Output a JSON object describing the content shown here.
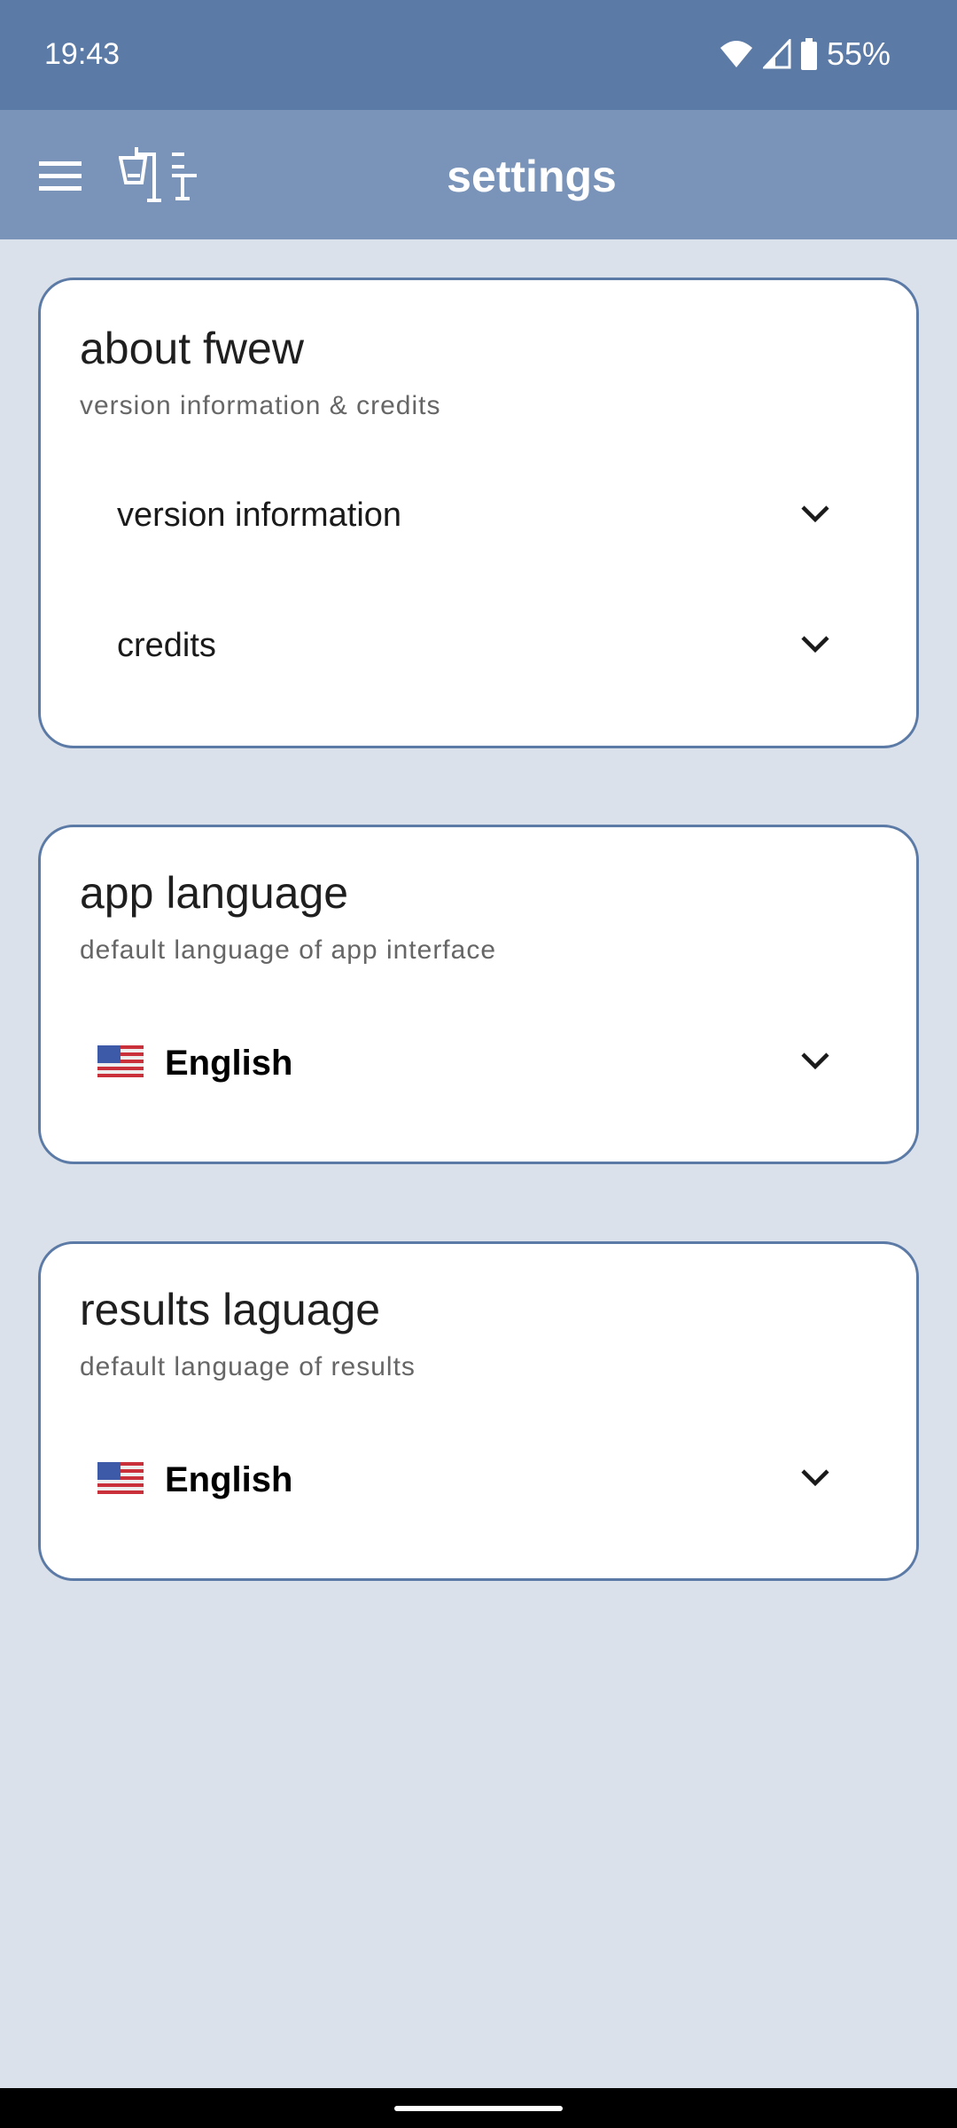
{
  "status": {
    "time": "19:43",
    "battery": "55%"
  },
  "appbar": {
    "title": "settings"
  },
  "about": {
    "title": "about fwew",
    "subtitle": "version information & credits",
    "items": [
      {
        "label": "version information"
      },
      {
        "label": "credits"
      }
    ]
  },
  "app_language": {
    "title": "app language",
    "subtitle": "default language of app interface",
    "selected": "English"
  },
  "results_language": {
    "title": "results laguage",
    "subtitle": "default language of results",
    "selected": "English"
  },
  "colors": {
    "status": "#5c7aa6",
    "appbar": "#7a94b9",
    "background": "#dae1eb"
  }
}
